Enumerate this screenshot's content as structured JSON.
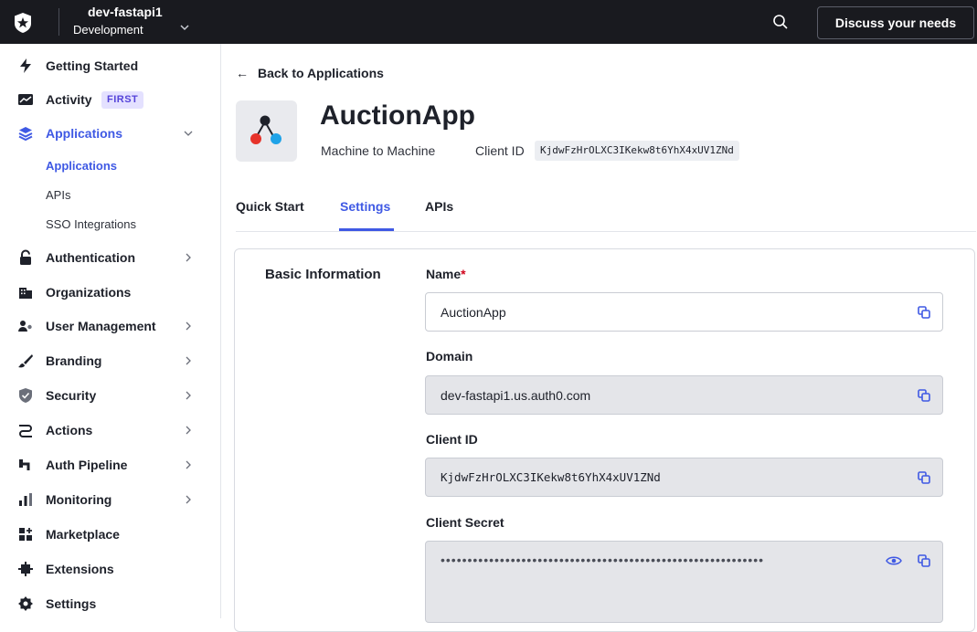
{
  "topbar": {
    "tenant_name": "dev-fastapi1",
    "tenant_env": "Development",
    "discuss_label": "Discuss your needs"
  },
  "sidebar": {
    "items": [
      {
        "label": "Getting Started",
        "icon": "lightning-icon"
      },
      {
        "label": "Activity",
        "icon": "activity-chart-icon",
        "badge": "FIRST"
      },
      {
        "label": "Applications",
        "icon": "layers-icon",
        "active": true,
        "expanded": true
      },
      {
        "label": "Authentication",
        "icon": "lock-icon"
      },
      {
        "label": "Organizations",
        "icon": "building-icon"
      },
      {
        "label": "User Management",
        "icon": "users-icon"
      },
      {
        "label": "Branding",
        "icon": "brush-icon"
      },
      {
        "label": "Security",
        "icon": "shield-icon"
      },
      {
        "label": "Actions",
        "icon": "actions-icon"
      },
      {
        "label": "Auth Pipeline",
        "icon": "pipeline-icon"
      },
      {
        "label": "Monitoring",
        "icon": "bar-chart-icon"
      },
      {
        "label": "Marketplace",
        "icon": "marketplace-icon"
      },
      {
        "label": "Extensions",
        "icon": "puzzle-icon"
      },
      {
        "label": "Settings",
        "icon": "gear-icon"
      }
    ],
    "subitems": [
      {
        "label": "Applications",
        "active": true
      },
      {
        "label": "APIs"
      },
      {
        "label": "SSO Integrations"
      }
    ]
  },
  "main": {
    "back_label": "Back to Applications",
    "app_name": "AuctionApp",
    "app_type": "Machine to Machine",
    "client_id_label": "Client ID",
    "client_id": "KjdwFzHrOLXC3IKekw8t6YhX4xUV1ZNd",
    "tabs": [
      {
        "label": "Quick Start"
      },
      {
        "label": "Settings",
        "active": true
      },
      {
        "label": "APIs"
      }
    ],
    "section_title": "Basic Information",
    "fields": {
      "name": {
        "label": "Name",
        "required_mark": "*",
        "value": "AuctionApp"
      },
      "domain": {
        "label": "Domain",
        "value": "dev-fastapi1.us.auth0.com"
      },
      "client_id": {
        "label": "Client ID",
        "value": "KjdwFzHrOLXC3IKekw8t6YhX4xUV1ZNd"
      },
      "client_secret": {
        "label": "Client Secret",
        "value": "••••••••••••••••••••••••••••••••••••••••••••••••••••••••••••"
      }
    }
  },
  "colors": {
    "accent": "#3f59e4",
    "topbar": "#191a1f",
    "badge_bg": "#e4e1ff",
    "badge_text": "#5443d9"
  }
}
